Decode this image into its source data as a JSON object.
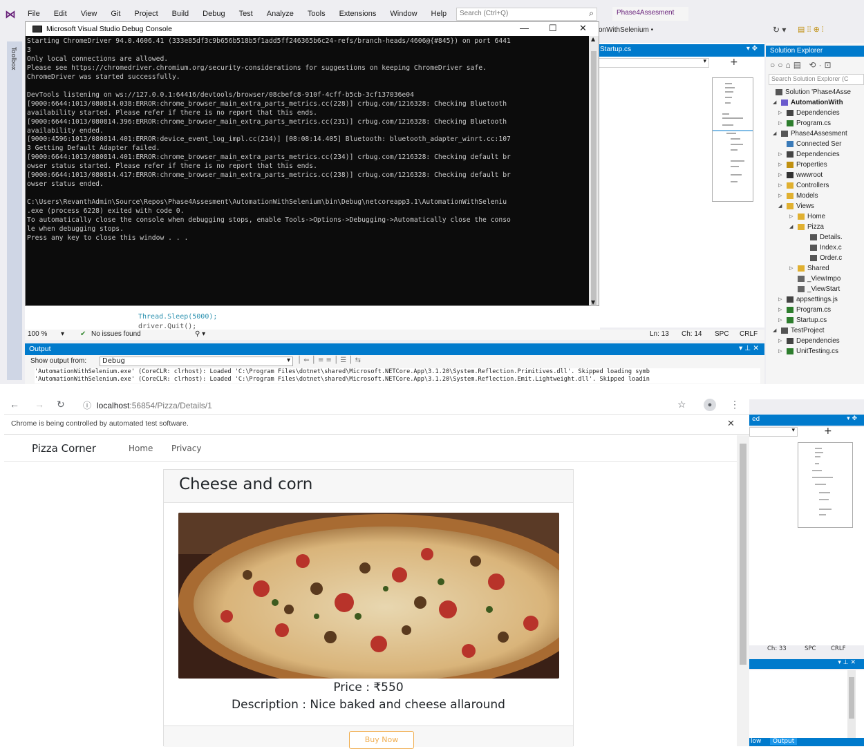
{
  "vs": {
    "menu": [
      "File",
      "Edit",
      "View",
      "Git",
      "Project",
      "Build",
      "Debug",
      "Test",
      "Analyze",
      "Tools",
      "Extensions",
      "Window",
      "Help"
    ],
    "search_placeholder": "Search (Ctrl+Q)",
    "project_name": "Phase4Assesment",
    "config_fragment": "onWithSelenium •",
    "toolbox_label": "Toolbox",
    "editor_tab": "Startup.cs",
    "code_line1": "Thread.Sleep(5000);",
    "code_line2": "driver.Quit();",
    "zoom": "100 %",
    "issues": "No issues found",
    "status": {
      "ln": "Ln: 13",
      "ch": "Ch: 14",
      "spc": "SPC",
      "crlf": "CRLF"
    },
    "output_title": "Output",
    "output_from_label": "Show output from:",
    "output_from_value": "Debug",
    "output_lines": [
      "'AutomationWithSelenium.exe' (CoreCLR: clrhost): Loaded 'C:\\Program Files\\dotnet\\shared\\Microsoft.NETCore.App\\3.1.20\\System.Reflection.Primitives.dll'. Skipped loading symb",
      "'AutomationWithSelenium.exe' (CoreCLR: clrhost): Loaded 'C:\\Program Files\\dotnet\\shared\\Microsoft.NETCore.App\\3.1.20\\System.Reflection.Emit.Lightweight.dll'. Skipped loadin"
    ]
  },
  "console": {
    "title": "Microsoft Visual Studio Debug Console",
    "lines": [
      "Starting ChromeDriver 94.0.4606.41 (333e85df3c9b656b518b5f1add5ff246365b6c24-refs/branch-heads/4606@{#845}) on port 6441",
      "3",
      "Only local connections are allowed.",
      "Please see https://chromedriver.chromium.org/security-considerations for suggestions on keeping ChromeDriver safe.",
      "ChromeDriver was started successfully.",
      "",
      "DevTools listening on ws://127.0.0.1:64416/devtools/browser/08cbefc8-910f-4cff-b5cb-3cf137036e04",
      "[9000:6644:1013/080814.038:ERROR:chrome_browser_main_extra_parts_metrics.cc(228)] crbug.com/1216328: Checking Bluetooth",
      "availability started. Please refer if there is no report that this ends.",
      "[9000:6644:1013/080814.396:ERROR:chrome_browser_main_extra_parts_metrics.cc(231)] crbug.com/1216328: Checking Bluetooth",
      "availability ended.",
      "[9000:4596:1013/080814.401:ERROR:device_event_log_impl.cc(214)] [08:08:14.405] Bluetooth: bluetooth_adapter_winrt.cc:107",
      "3 Getting Default Adapter failed.",
      "[9000:6644:1013/080814.401:ERROR:chrome_browser_main_extra_parts_metrics.cc(234)] crbug.com/1216328: Checking default br",
      "owser status started. Please refer if there is no report that this ends.",
      "[9000:6644:1013/080814.417:ERROR:chrome_browser_main_extra_parts_metrics.cc(238)] crbug.com/1216328: Checking default br",
      "owser status ended.",
      "",
      "C:\\Users\\RevanthAdmin\\Source\\Repos\\Phase4Assesment\\AutomationWithSelenium\\bin\\Debug\\netcoreapp3.1\\AutomationWithSeleniu",
      ".exe (process 6228) exited with code 0.",
      "To automatically close the console when debugging stops, enable Tools->Options->Debugging->Automatically close the conso",
      "le when debugging stops.",
      "Press any key to close this window . . ."
    ]
  },
  "solution_explorer": {
    "title": "Solution Explorer",
    "search_placeholder": "Search Solution Explorer (C",
    "items": [
      {
        "label": "Solution 'Phase4Asse",
        "bold": false
      },
      {
        "label": "AutomationWith",
        "bold": true
      },
      {
        "label": "Dependencies",
        "bold": false
      },
      {
        "label": "Program.cs",
        "bold": false
      },
      {
        "label": "Phase4Assesment",
        "bold": false
      },
      {
        "label": "Connected Ser",
        "bold": false
      },
      {
        "label": "Dependencies",
        "bold": false
      },
      {
        "label": "Properties",
        "bold": false
      },
      {
        "label": "wwwroot",
        "bold": false
      },
      {
        "label": "Controllers",
        "bold": false
      },
      {
        "label": "Models",
        "bold": false
      },
      {
        "label": "Views",
        "bold": false
      },
      {
        "label": "Home",
        "bold": false
      },
      {
        "label": "Pizza",
        "bold": false
      },
      {
        "label": "Details.",
        "bold": false
      },
      {
        "label": "Index.c",
        "bold": false
      },
      {
        "label": "Order.c",
        "bold": false
      },
      {
        "label": "Shared",
        "bold": false
      },
      {
        "label": "_ViewImpo",
        "bold": false
      },
      {
        "label": "_ViewStart",
        "bold": false
      },
      {
        "label": "appsettings.js",
        "bold": false
      },
      {
        "label": "Program.cs",
        "bold": false
      },
      {
        "label": "Startup.cs",
        "bold": false
      },
      {
        "label": "TestProject",
        "bold": false
      },
      {
        "label": "Dependencies",
        "bold": false
      },
      {
        "label": "UnitTesting.cs",
        "bold": false
      }
    ]
  },
  "browser": {
    "url_host": "localhost",
    "url_path": ":56854/Pizza/Details/1",
    "infobar": "Chrome is being controlled by automated test software.",
    "brand": "Pizza Corner",
    "nav": [
      "Home",
      "Privacy"
    ],
    "pizza_name": "Cheese and corn",
    "price": "Price : ₹550",
    "description": "Description : Nice baked and cheese allaround",
    "buy_label": "Buy Now"
  },
  "vs2": {
    "status_frag": "Ch: 33",
    "spc": "SPC",
    "crlf": "CRLF",
    "bottom_tab1": "low",
    "bottom_tab2": "Output",
    "title_frag": "ed"
  },
  "colors": {
    "vs_blue": "#007acc",
    "vs_purple": "#68217a",
    "console_bg": "#0c0c0c",
    "bootstrap_warning": "#f0ad4e"
  }
}
